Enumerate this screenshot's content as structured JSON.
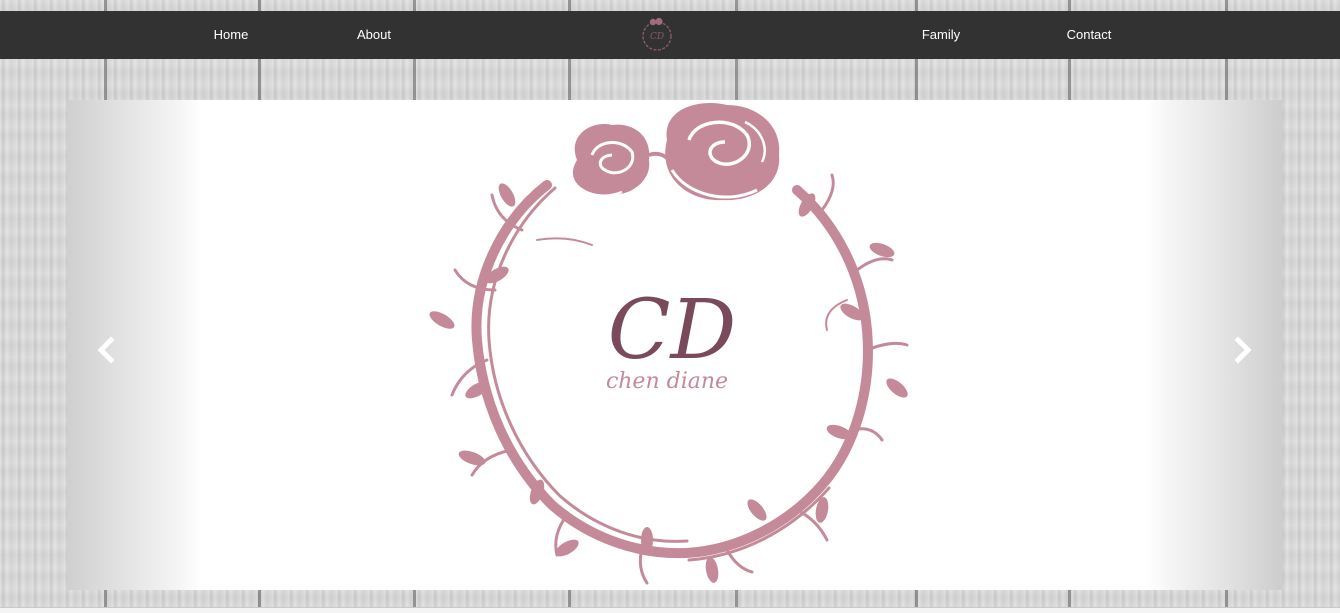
{
  "nav": {
    "links": [
      {
        "label": "Home"
      },
      {
        "label": "About"
      },
      {
        "label": "Family"
      },
      {
        "label": "Contact"
      }
    ],
    "logo": {
      "monogram": "CD"
    }
  },
  "carousel": {
    "slide": {
      "monogram": "CD",
      "name": "chen diane"
    },
    "prev_icon": "chevron-left-icon",
    "next_icon": "chevron-right-icon"
  },
  "colors": {
    "nav_bg": "#323232",
    "nav_text": "#ffffff",
    "rose": "#c48a9a",
    "monogram": "#7a4a5c"
  }
}
